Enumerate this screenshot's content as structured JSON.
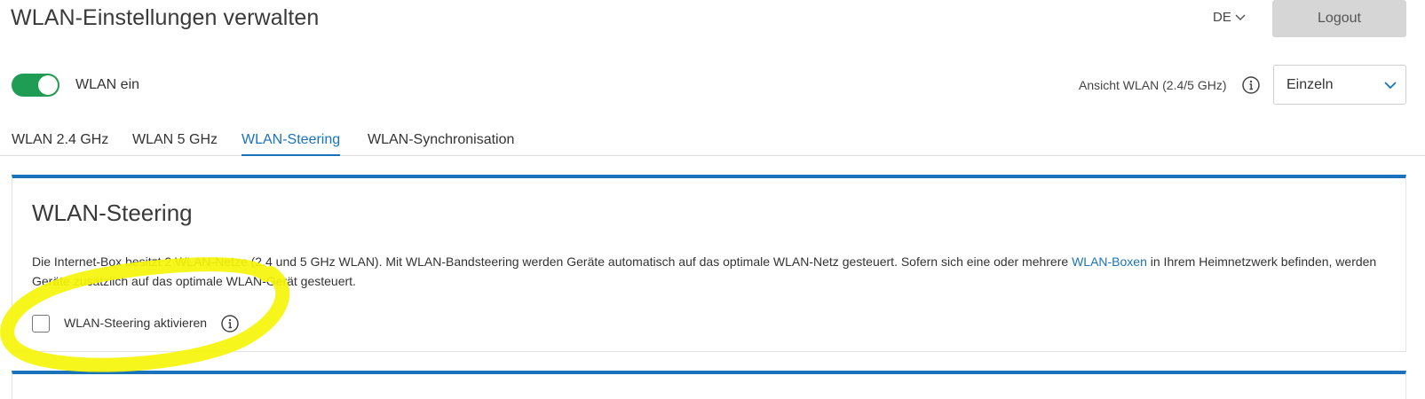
{
  "header": {
    "title": "WLAN-Einstellungen verwalten",
    "language": "DE",
    "logout_label": "Logout"
  },
  "wlan_toggle": {
    "label": "WLAN ein",
    "state": "on"
  },
  "view": {
    "label": "Ansicht WLAN (2.4/5 GHz)",
    "selected": "Einzeln"
  },
  "tabs": [
    {
      "label": "WLAN 2.4 GHz"
    },
    {
      "label": "WLAN 5 GHz"
    },
    {
      "label": "WLAN-Steering",
      "active": true
    },
    {
      "label": "WLAN-Synchronisation"
    }
  ],
  "steering_card": {
    "title": "WLAN-Steering",
    "description_part1": "Die Internet-Box besitzt 2 WLAN-Netze (2.4 und 5 GHz WLAN). Mit WLAN-Bandsteering werden Geräte automatisch auf das optimale WLAN-Netz gesteuert. Sofern sich eine oder mehrere ",
    "description_link": "WLAN-Boxen",
    "description_part2": " in Ihrem Heimnetzwerk befinden, werden Geräte zusätzlich auf das optimale WLAN-Gerät gesteuert.",
    "checkbox_label": "WLAN-Steering aktivieren",
    "checkbox_checked": false
  },
  "colors": {
    "accent": "#1a73ba",
    "toggle_on": "#1f9d55",
    "highlight": "#f5f50a"
  }
}
